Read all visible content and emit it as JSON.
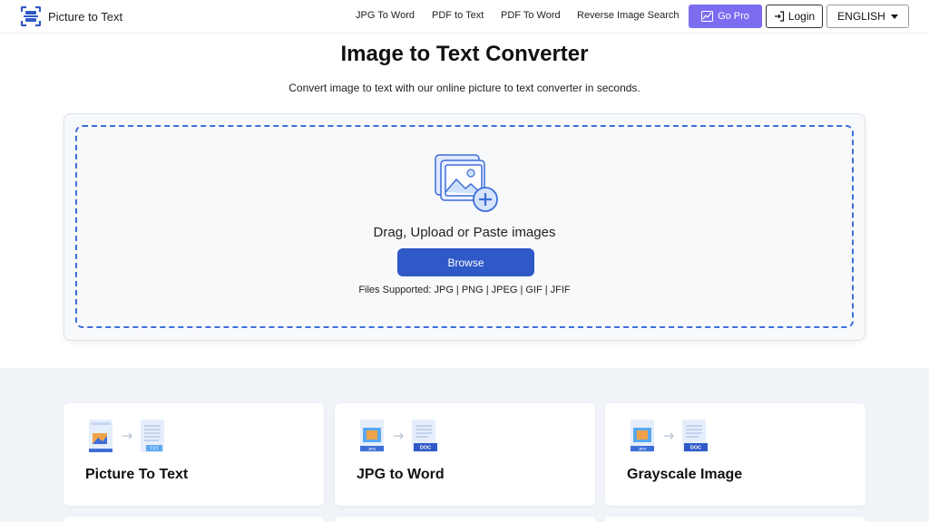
{
  "header": {
    "logo_text": "Picture to Text",
    "nav": [
      "JPG To Word",
      "PDF to Text",
      "PDF To Word",
      "Reverse Image Search"
    ],
    "go_pro": "Go Pro",
    "login": "Login",
    "language": "ENGLISH"
  },
  "hero": {
    "title": "Image to Text Converter",
    "subtitle": "Convert image to text with our online picture to text converter in seconds."
  },
  "upload": {
    "drop_text": "Drag, Upload or Paste images",
    "browse": "Browse",
    "files_supported": "Files Supported: JPG | PNG | JPEG | GIF | JFIF"
  },
  "tools": [
    {
      "label": "Picture To Text",
      "badge": "TXT"
    },
    {
      "label": "JPG to Word",
      "badge": "DOC"
    },
    {
      "label": "Grayscale Image",
      "badge": "DOC"
    }
  ],
  "tool_icon_source_label": "JPG",
  "colors": {
    "accent": "#2f59c7",
    "go_pro": "#7c6cf0",
    "dash": "#3e6ed8"
  }
}
